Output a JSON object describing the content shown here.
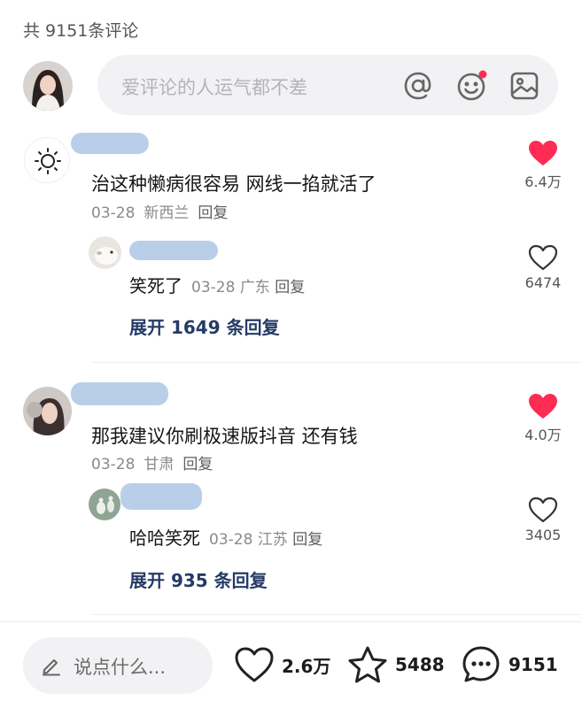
{
  "header": {
    "count": "共 9151条评论"
  },
  "composer": {
    "placeholder": "爱评论的人运气都不差",
    "icons": [
      "at-icon",
      "emoji-icon",
      "image-icon"
    ],
    "emoji_dot_color": "#fe2c55"
  },
  "comments": [
    {
      "text": "治这种懒病很容易 网线一掐就活了",
      "date": "03-28",
      "location": "新西兰",
      "reply_label": "回复",
      "likes": "6.4万",
      "liked": true,
      "reply": {
        "text": "笑死了",
        "date": "03-28",
        "location": "广东",
        "reply_label": "回复",
        "likes": "6474",
        "liked": false
      },
      "expand": "展开 1649 条回复"
    },
    {
      "text": "那我建议你刷极速版抖音 还有钱",
      "date": "03-28",
      "location": "甘肃",
      "reply_label": "回复",
      "likes": "4.0万",
      "liked": true,
      "reply": {
        "text": "哈哈笑死",
        "date": "03-28",
        "location": "江苏",
        "reply_label": "回复",
        "likes": "3405",
        "liked": false
      },
      "expand": "展开 935 条回复"
    }
  ],
  "bottom_bar": {
    "say_placeholder": "说点什么...",
    "likes": "2.6万",
    "favorites": "5488",
    "comments": "9151"
  },
  "colors": {
    "liked_heart": "#fe2c55",
    "expand_link": "#243b66",
    "name_blur": "#b9cfe9"
  }
}
